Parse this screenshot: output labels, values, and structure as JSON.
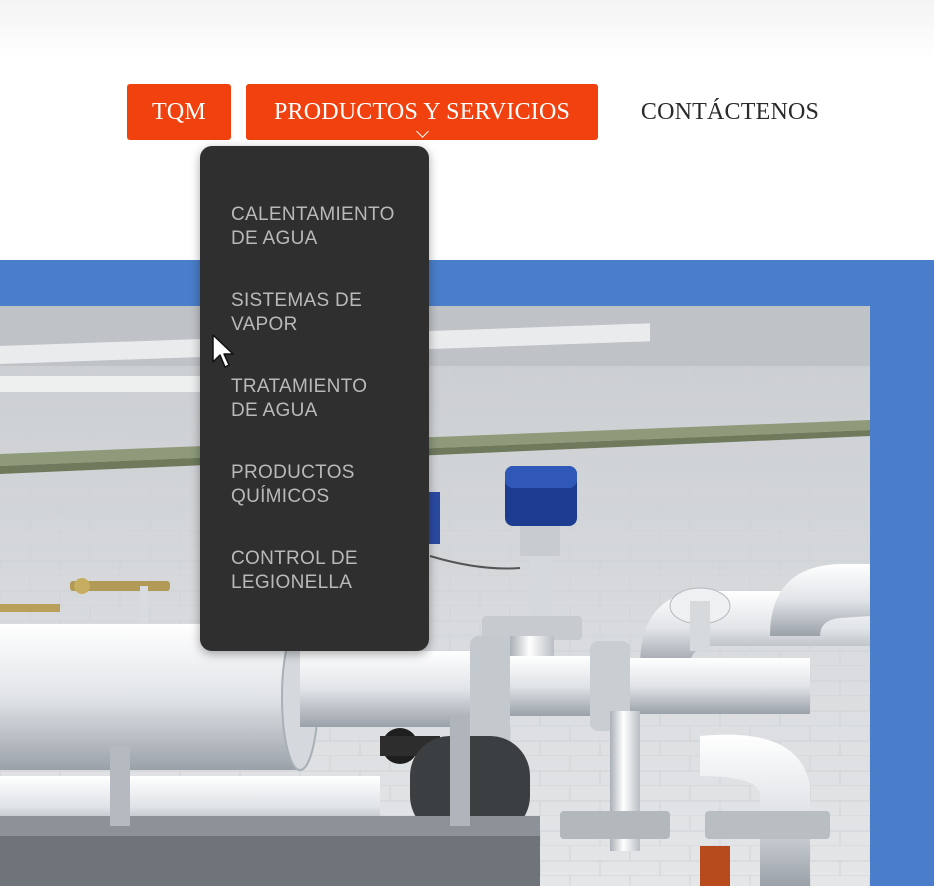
{
  "nav": {
    "items": [
      {
        "label": "TQM",
        "active": true
      },
      {
        "label": "PRODUCTOS Y SERVICIOS",
        "active": true,
        "expanded": true
      },
      {
        "label": "CONTÁCTENOS",
        "active": false
      }
    ]
  },
  "dropdown": {
    "items": [
      {
        "line1": "CALENTAMIENTO",
        "line2": "DE AGUA"
      },
      {
        "line1": "SISTEMAS DE",
        "line2": "VAPOR"
      },
      {
        "line1": "TRATAMIENTO",
        "line2": "DE AGUA"
      },
      {
        "line1": "PRODUCTOS",
        "line2": "QUÍMICOS"
      },
      {
        "line1": "CONTROL DE",
        "line2": "LEGIONELLA"
      }
    ]
  },
  "colors": {
    "accent": "#f0410e",
    "band": "#4a7ecb",
    "dropdown_bg": "#2f2f2f",
    "dropdown_text": "#b9b9b9"
  },
  "icons": {
    "dropdown_indicator": "chevron-down-icon",
    "pointer": "mouse-cursor-icon"
  }
}
